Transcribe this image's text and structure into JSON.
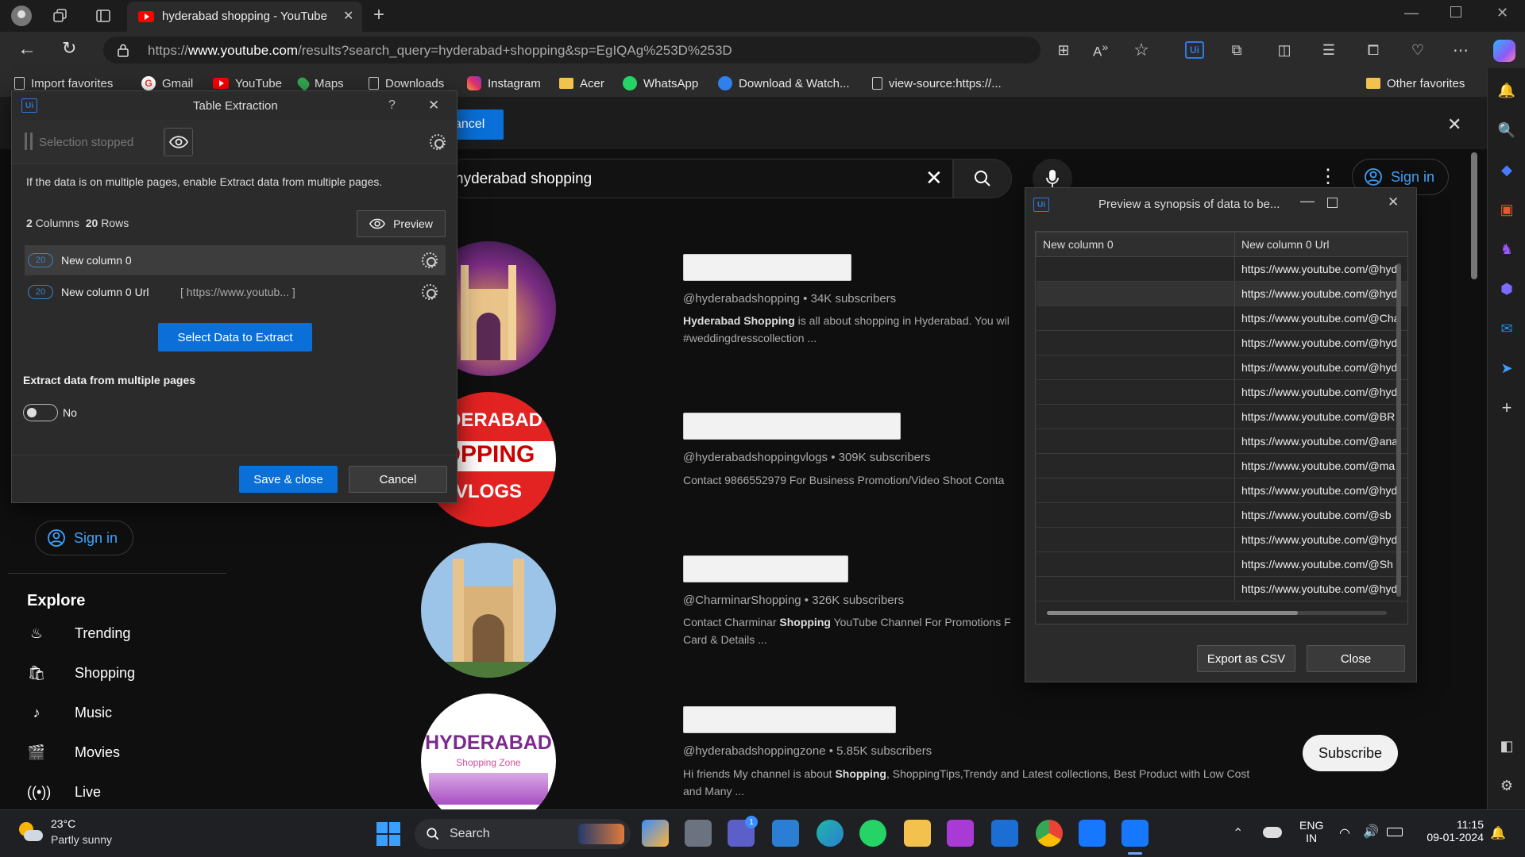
{
  "browser": {
    "tab_title": "hyderabad shopping - YouTube",
    "url_prefix": "https://",
    "url_domain": "www.youtube.com",
    "url_path": "/results?search_query=hyderabad+shopping&sp=EgIQAg%253D%253D"
  },
  "favorites": {
    "items": [
      "Import favorites",
      "Gmail",
      "YouTube",
      "Maps",
      "Downloads",
      "Instagram",
      "Acer",
      "WhatsApp",
      "Download & Watch...",
      "view-source:https://..."
    ],
    "other": "Other favorites"
  },
  "youtube": {
    "search_text": "hyderabad shopping",
    "sign_in": "Sign in",
    "sidebar_sign_in": "Sign in",
    "explore_title": "Explore",
    "explore_items": [
      "Trending",
      "Shopping",
      "Music",
      "Movies",
      "Live"
    ],
    "cancel_fragment": "ancel",
    "subscribe": "Subscribe",
    "results": [
      {
        "handle": "@hyderabadshopping",
        "subs": "34K subscribers",
        "desc_bold": "Hyderabad Shopping",
        "desc_rest": " is all about shopping in Hyderabad. You wil",
        "desc_line2": "#weddingdresscollection ..."
      },
      {
        "handle": "@hyderabadshoppingvlogs",
        "subs": "309K subscribers",
        "desc_bold": "",
        "desc_rest": "Contact 9866552979 For Business Promotion/Video Shoot Conta",
        "desc_line2": ""
      },
      {
        "handle": "@CharminarShopping",
        "subs": "326K subscribers",
        "desc_bold": "Shopping",
        "desc_pre": "Contact Charminar ",
        "desc_rest": " YouTube Channel For Promotions F",
        "desc_line2": "Card & Details ..."
      },
      {
        "handle": "@hyderabadshoppingzone",
        "subs": "5.85K subscribers",
        "desc_pre": "Hi friends My channel is about ",
        "desc_bold": "Shopping",
        "desc_rest": ", ShoppingTips,Trendy and Latest collections, Best Product with Low Cost",
        "desc_line2": "and Many ..."
      }
    ],
    "thumb2_text": [
      "YDERABAD",
      "OPPING",
      "VLOGS"
    ],
    "thumb4_text": [
      "HYDERABAD",
      "Shopping Zone"
    ]
  },
  "table_extraction": {
    "title": "Table Extraction",
    "selection_status": "Selection stopped",
    "info": "If the data is on multiple pages, enable Extract data from multiple pages.",
    "columns_count": "2",
    "columns_label": "Columns",
    "rows_count": "20",
    "rows_label": "Rows",
    "preview_label": "Preview",
    "columns": [
      {
        "badge": "20",
        "name": "New column 0",
        "sample": ""
      },
      {
        "badge": "20",
        "name": "New column 0 Url",
        "sample": "[ https://www.youtub... ]"
      }
    ],
    "select_data_label": "Select Data to Extract",
    "multi_page_label": "Extract data from multiple pages",
    "toggle_value": "No",
    "toggle_on": false,
    "save_label": "Save & close",
    "cancel_label": "Cancel"
  },
  "preview_dialog": {
    "title": "Preview a synopsis of data to be...",
    "headers": [
      "New column 0",
      "New column 0 Url"
    ],
    "rows": [
      [
        "",
        "https://www.youtube.com/@hyd"
      ],
      [
        "",
        "https://www.youtube.com/@hyd"
      ],
      [
        "",
        "https://www.youtube.com/@Cha"
      ],
      [
        "",
        "https://www.youtube.com/@hyd"
      ],
      [
        "",
        "https://www.youtube.com/@hyd"
      ],
      [
        "",
        "https://www.youtube.com/@hyd"
      ],
      [
        "",
        "https://www.youtube.com/@BR"
      ],
      [
        "",
        "https://www.youtube.com/@ana"
      ],
      [
        "",
        "https://www.youtube.com/@ma"
      ],
      [
        "",
        "https://www.youtube.com/@hyd"
      ],
      [
        "",
        "https://www.youtube.com/@sb"
      ],
      [
        "",
        "https://www.youtube.com/@hyd"
      ],
      [
        "",
        "https://www.youtube.com/@Sh"
      ],
      [
        "",
        "https://www.youtube.com/@hyd"
      ]
    ],
    "export_label": "Export as CSV",
    "close_label": "Close"
  },
  "taskbar": {
    "temp": "23°C",
    "weather": "Partly sunny",
    "search_label": "Search",
    "lang1": "ENG",
    "lang2": "IN",
    "time": "11:15",
    "date": "09-01-2024",
    "teams_badge": "1"
  }
}
